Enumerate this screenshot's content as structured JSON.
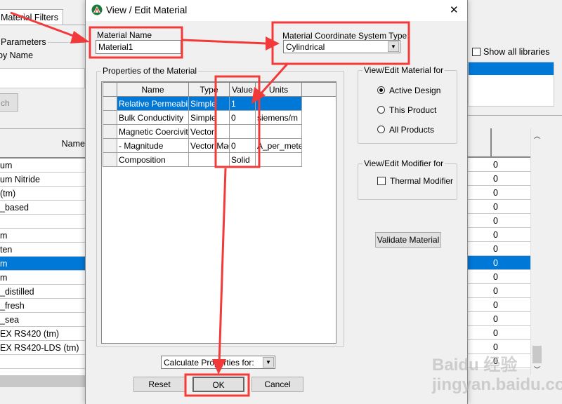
{
  "background": {
    "tab_label": "Material Filters",
    "group_label": "Parameters",
    "by_name_label": "by Name",
    "search_button": "ch",
    "name_column": "Name",
    "rows": [
      "um",
      "um Nitride",
      "(tm)",
      "_based",
      "",
      "m",
      "ten",
      "m",
      "m",
      "_distilled",
      "_fresh",
      "_sea",
      "EX RS420 (tm)",
      "EX RS420-LDS (tm)",
      ""
    ],
    "selected_row": 7,
    "show_all_libraries": "Show all libraries",
    "right_values": [
      "0",
      "0",
      "0",
      "0",
      "0",
      "0",
      "0",
      "0",
      "0",
      "0",
      "0",
      "0",
      "0",
      "0",
      "0"
    ]
  },
  "dialog": {
    "title": "View / Edit Material",
    "close": "✕",
    "material_name_label": "Material Name",
    "material_name_value": "Material1",
    "coord_label": "Material Coordinate System Type:",
    "coord_value": "Cylindrical",
    "properties_group": "Properties of the Material",
    "columns": [
      "Name",
      "Type",
      "Value",
      "Units"
    ],
    "properties": [
      {
        "name": "Relative Permeability",
        "type": "Simple",
        "value": "1",
        "units": ""
      },
      {
        "name": "Bulk Conductivity",
        "type": "Simple",
        "value": "0",
        "units": "siemens/m"
      },
      {
        "name": "Magnetic Coercivity",
        "type": "Vector",
        "value": "",
        "units": ""
      },
      {
        "name": "-  Magnitude",
        "type": "Vector Mag",
        "value": "0",
        "units": "A_per_meter"
      },
      {
        "name": "Composition",
        "type": "",
        "value": "Solid",
        "units": ""
      }
    ],
    "view_edit_for": {
      "label": "View/Edit Material for",
      "options": [
        "Active Design",
        "This Product",
        "All Products"
      ],
      "selected": 0
    },
    "modifier": {
      "label": "View/Edit Modifier for",
      "checkbox": "Thermal Modifier"
    },
    "validate_button": "Validate Material",
    "calculate_select": "Calculate Properties for:",
    "reset_button": "Reset",
    "ok_button": "OK",
    "cancel_button": "Cancel"
  },
  "watermark": "Baidu 经验 jingyan.baidu.com",
  "colors": {
    "selection": "#0078d7",
    "annotation": "#f23a3a"
  }
}
